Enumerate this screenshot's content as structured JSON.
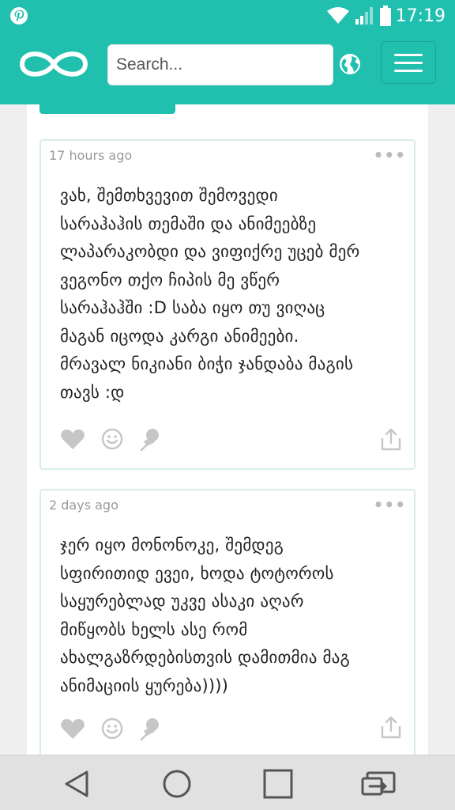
{
  "status_bar": {
    "time": "17:19",
    "icons": [
      "pinterest-icon",
      "wifi-icon",
      "signal-icon",
      "battery-icon"
    ]
  },
  "header": {
    "logo_icon": "infinity-logo-icon",
    "search_placeholder": "Search...",
    "globe_icon": "globe-icon",
    "menu_icon": "hamburger-menu-icon"
  },
  "posts": [
    {
      "time": "17 hours ago",
      "more": "•••",
      "lines": [
        "ვახ, შემთხვევით შემოვედი",
        "სარაჰაჰის თემაში და ანიმეებზე",
        "ლაპარაკობდი და ვიფიქრე უცებ მერ",
        "ვეგონო თქო ჩიპის მე ვწერ",
        "სარაჰაჰში :D საბა იყო თუ ვიღაც",
        "მაგან იცოდა კარგი ანიმეები.",
        "მრავალ ნიკიანი ბიჭი ჯანდაბა მაგის",
        "თავს :დ"
      ]
    },
    {
      "time": "2 days ago",
      "more": "•••",
      "lines": [
        "ჯერ იყო მონონოკე, შემდეგ",
        "სფირითიდ ევეი, ხოდა ტოტოროს",
        "საყურებლად უკვე ასაკი აღარ",
        "მიწყობს ხელს ასე რომ",
        "ახალგაზრდებისთვის დამითმია მაგ",
        "ანიმაციის ყურება))))"
      ]
    }
  ],
  "colors": {
    "brand": "#21bfae",
    "icon_gray": "#c6c6c6",
    "nav_bg": "#e1e1e1"
  },
  "nav": [
    "back-icon",
    "home-icon",
    "recents-icon",
    "screen-mirror-icon"
  ]
}
